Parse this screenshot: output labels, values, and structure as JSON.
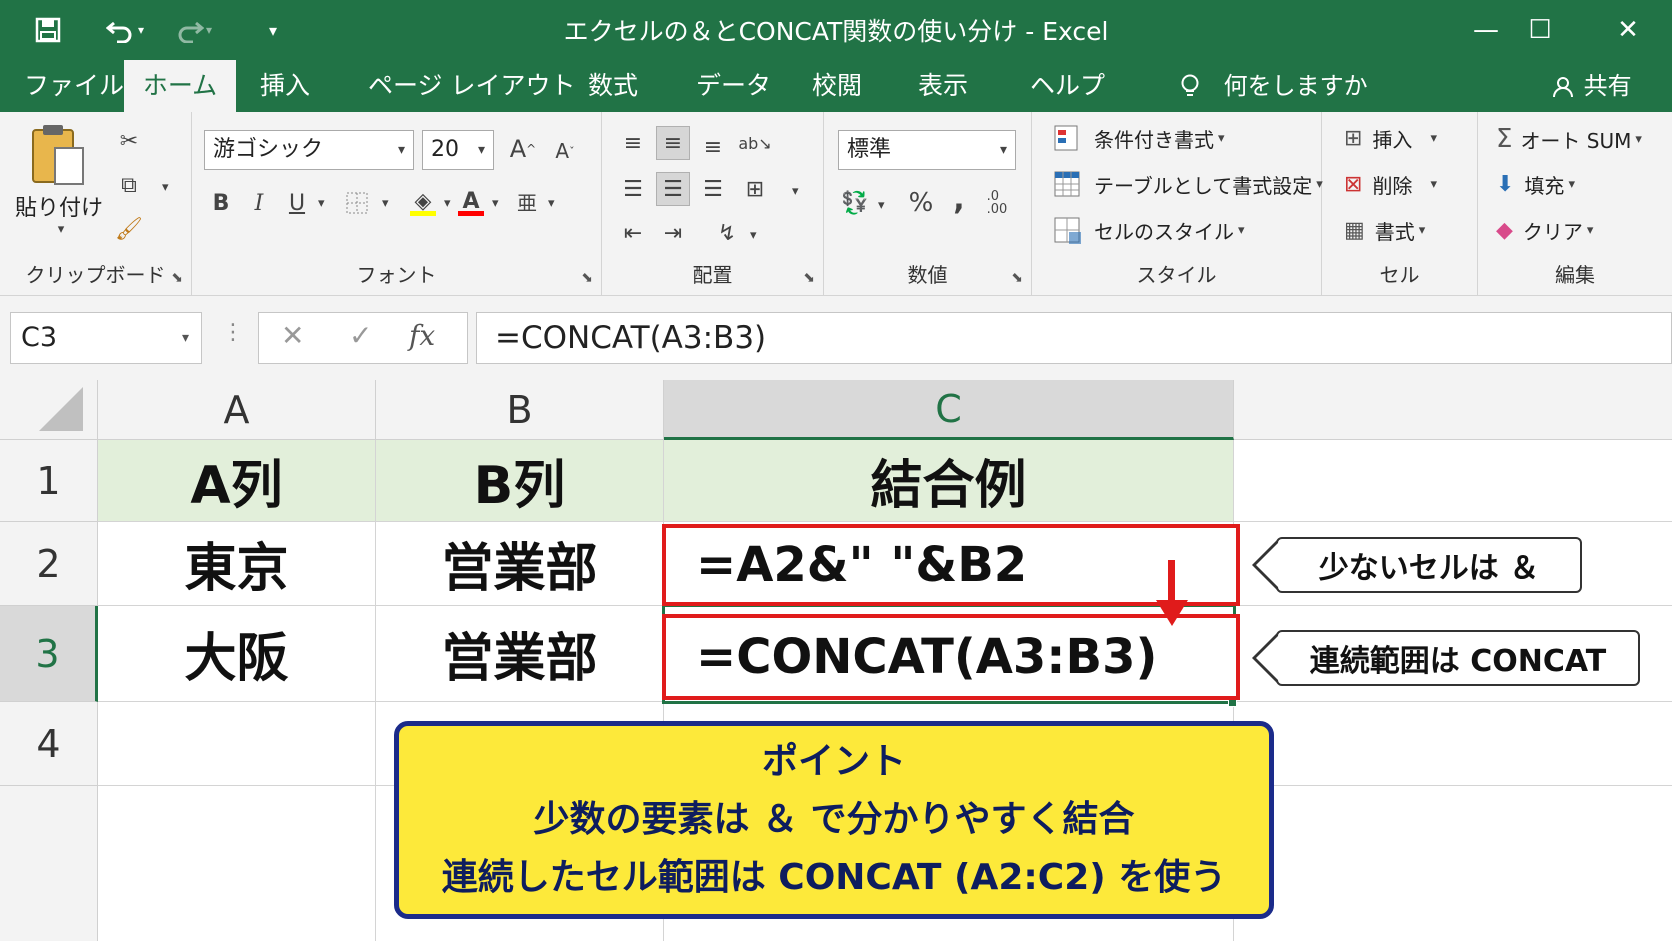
{
  "window": {
    "title": "エクセルの＆とCONCAT関数の使い分け  -  Excel",
    "quick_access": [
      "save-icon",
      "undo-icon",
      "redo-icon",
      "customize-icon"
    ],
    "controls": [
      "minimize-icon",
      "maximize-icon",
      "close-icon"
    ]
  },
  "tabs": [
    {
      "label": "ファイル",
      "active": false
    },
    {
      "label": "ホーム",
      "active": true
    },
    {
      "label": "挿入",
      "active": false
    },
    {
      "label": "ページ レイアウト",
      "active": false
    },
    {
      "label": "数式",
      "active": false
    },
    {
      "label": "データ",
      "active": false
    },
    {
      "label": "校閲",
      "active": false
    },
    {
      "label": "表示",
      "active": false
    },
    {
      "label": "ヘルプ",
      "active": false
    }
  ],
  "tellme": "何をしますか",
  "share": "共有",
  "ribbon": {
    "clipboard": {
      "label": "クリップボード",
      "paste": "貼り付け"
    },
    "font": {
      "label": "フォント",
      "name": "游ゴシック",
      "size": "20",
      "bold": "B",
      "italic": "I",
      "underline": "U"
    },
    "alignment": {
      "label": "配置"
    },
    "number": {
      "label": "数値",
      "format": "標準",
      "percent": "%",
      "comma": ","
    },
    "styles": {
      "label": "スタイル",
      "conditional": "条件付き書式",
      "table": "テーブルとして書式設定",
      "cell_styles": "セルのスタイル"
    },
    "cells": {
      "label": "セル",
      "insert": "挿入",
      "delete": "削除",
      "format": "書式"
    },
    "editing": {
      "label": "編集",
      "autosum": "オート SUM",
      "fill": "填充",
      "clear": "クリア"
    }
  },
  "formula_bar": {
    "name_box": "C3",
    "formula": "=CONCAT(A3:B3)",
    "fx": "fx"
  },
  "sheet": {
    "columns": [
      "A",
      "B",
      "C"
    ],
    "rows": [
      "1",
      "2",
      "3",
      "4"
    ],
    "header_row": [
      "A列",
      "B列",
      "結合例"
    ],
    "data": [
      {
        "a": "東京",
        "b": "営業部",
        "c": "=A2&\" \"&B2"
      },
      {
        "a": "大阪",
        "b": "営業部",
        "c": "=CONCAT(A3:B3)"
      }
    ]
  },
  "callouts": {
    "amp": "少ないセルは ＆",
    "concat": "連続範囲は CONCAT"
  },
  "point": {
    "title": "ポイント",
    "line1": "少数の要素は ＆ で分かりやすく結合",
    "line2": "連続したセル範囲は CONCAT (A2:C2) を使う"
  },
  "colors": {
    "excel_green": "#217346",
    "highlight_red": "#e01b1b",
    "point_yellow": "#fde93a",
    "point_border": "#1b2b8a"
  }
}
